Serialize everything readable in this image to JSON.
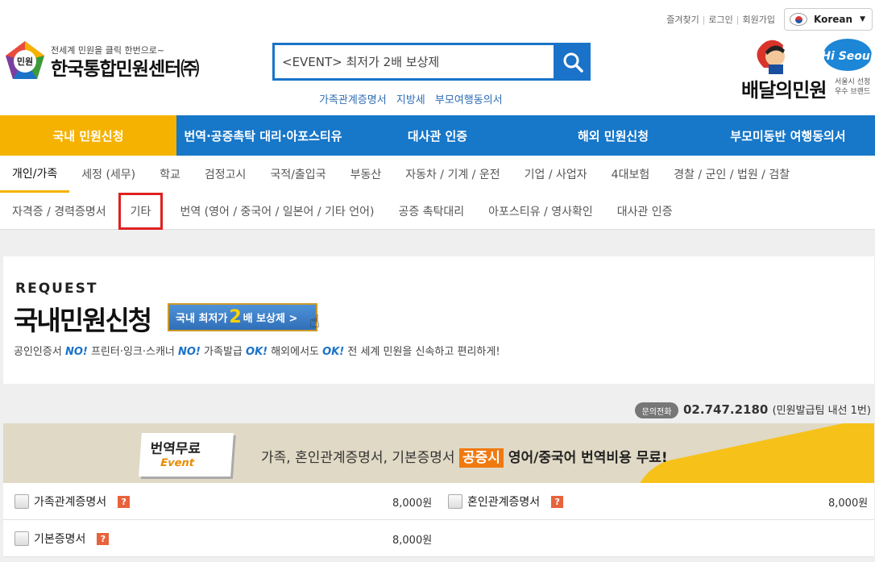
{
  "header": {
    "top_links": [
      "즐겨찾기",
      "로그인",
      "회원가입"
    ],
    "language": "Korean",
    "logo_small": "전세계 민원을 클릭 한번으로~",
    "logo_big": "한국통합민원센터㈜",
    "logo_mark_text": "민원",
    "search_value": "<EVENT> 최저가 2배 보상제",
    "keywords": [
      "가족관계증명서",
      "지방세",
      "부모여행동의서"
    ],
    "brand_text": "배달의민원",
    "brand_sub": "서울시 선정\n우수 브랜드",
    "brand_badge": "Hi Seoul"
  },
  "main_nav": [
    "국내 민원신청",
    "번역·공증촉탁 대리·아포스티유",
    "대사관 인증",
    "해외 민원신청",
    "부모미동반 여행동의서"
  ],
  "sub_nav_row1": [
    "개인/가족",
    "세정 (세무)",
    "학교",
    "검정고시",
    "국적/출입국",
    "부동산",
    "자동차 / 기계 / 운전",
    "기업 / 사업자",
    "4대보험",
    "경찰 / 군인 / 법원 / 검찰"
  ],
  "sub_nav_row2": [
    "자격증 / 경력증명서",
    "기타",
    "번역 (영어 / 중국어 / 일본어 / 기타 언어)",
    "공증 촉탁대리",
    "아포스티유 / 영사확인",
    "대사관 인증"
  ],
  "request": {
    "label": "REQUEST",
    "title": "국내민원신청",
    "badge_pre": "국내 최저가",
    "badge_num": "2",
    "badge_post": "배 보상제 >",
    "desc_parts": [
      "공인인증서 ",
      "NO!",
      " 프린터·잉크·스캐너 ",
      "NO!",
      " 가족발급 ",
      "OK!",
      " 해외에서도 ",
      "OK!",
      " 전 세계 민원을 신속하고 편리하게!"
    ]
  },
  "phone": {
    "badge": "문의전화",
    "number": "02.747.2180",
    "note": "(민원발급팀 내선 1번)"
  },
  "event": {
    "card_title": "번역무료",
    "card_sub": "Event",
    "text_pre": "가족, 혼인관계증명서, 기본증명서 ",
    "highlight": "공증시",
    "text_post": " 영어/중국어 번역비용 무료!"
  },
  "items": [
    {
      "name": "가족관계증명서",
      "price": "8,000원"
    },
    {
      "name": "혼인관계증명서",
      "price": "8,000원"
    },
    {
      "name": "기본증명서",
      "price": "8,000원"
    }
  ],
  "colors": {
    "primary_blue": "#1777c8",
    "active_yellow": "#f6b200",
    "highlight_red": "#e02020"
  }
}
